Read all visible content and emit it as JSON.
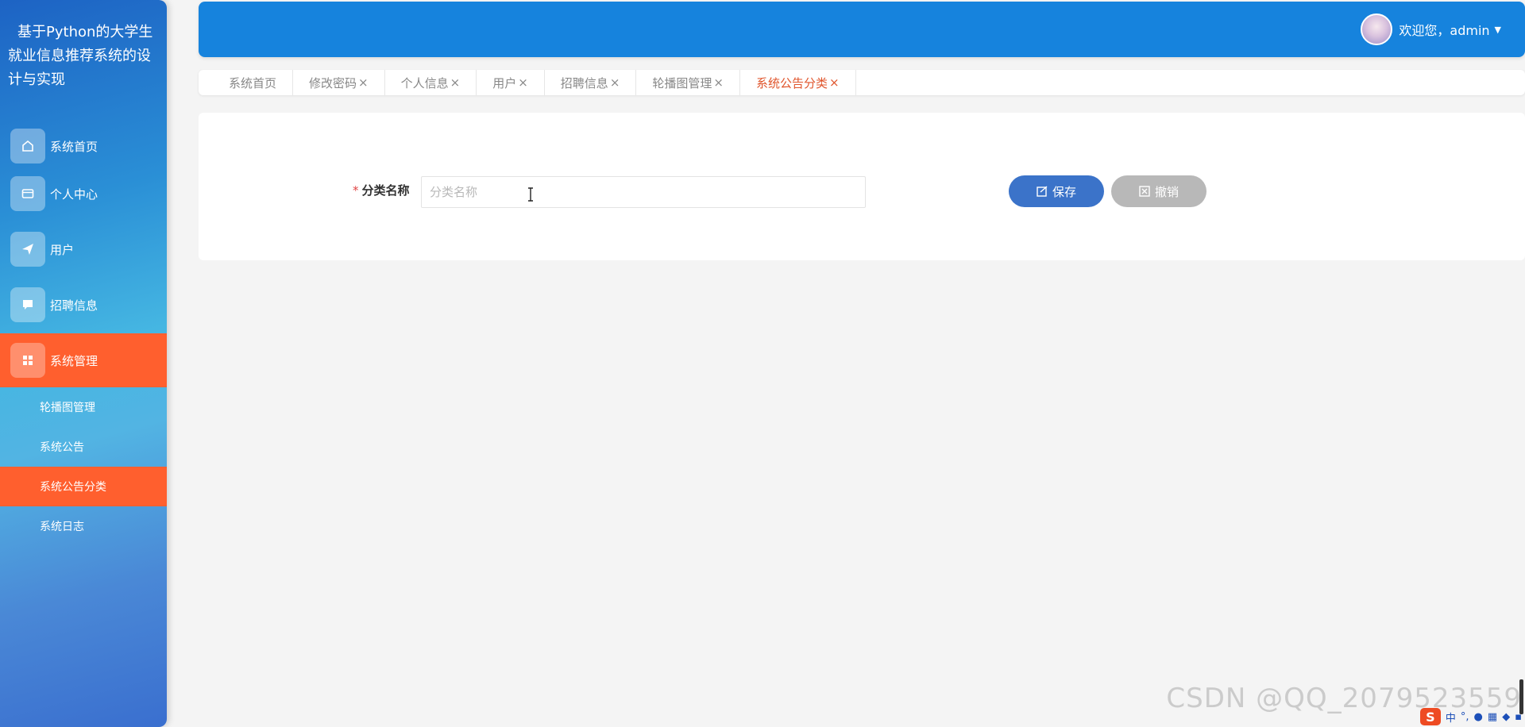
{
  "sidebar": {
    "title": "基于Python的大学生就业信息推荐系统的设计与实现",
    "menu": [
      {
        "label": "系统首页",
        "icon": "home-icon"
      },
      {
        "label": "个人中心",
        "icon": "wallet-icon"
      },
      {
        "label": "用户",
        "icon": "send-icon"
      },
      {
        "label": "招聘信息",
        "icon": "message-icon"
      },
      {
        "label": "系统管理",
        "icon": "grid-icon"
      }
    ],
    "submenu": [
      {
        "label": "轮播图管理"
      },
      {
        "label": "系统公告"
      },
      {
        "label": "系统公告分类"
      },
      {
        "label": "系统日志"
      }
    ]
  },
  "header": {
    "welcome": "欢迎您，admin",
    "dropdown_icon": "caret-down-icon"
  },
  "tabs": [
    {
      "label": "系统首页"
    },
    {
      "label": "修改密码",
      "close": "×"
    },
    {
      "label": "个人信息",
      "close": "×"
    },
    {
      "label": "用户",
      "close": "×"
    },
    {
      "label": "招聘信息",
      "close": "×"
    },
    {
      "label": "轮播图管理",
      "close": "×"
    },
    {
      "label": "系统公告分类",
      "close": "×"
    }
  ],
  "form": {
    "required_mark": "*",
    "label": "分类名称",
    "placeholder": "分类名称",
    "value": ""
  },
  "buttons": {
    "save": "保存",
    "cancel": "撤销"
  },
  "watermark": "CSDN @QQ_2079523559",
  "tray": {
    "ime_logo": "S",
    "ime_mode": "中"
  },
  "colors": {
    "header": "#1683dd",
    "active": "#ff5f2e",
    "save": "#3b73c9",
    "cancel": "#b8b8b8",
    "active_tab": "#e0552c"
  }
}
